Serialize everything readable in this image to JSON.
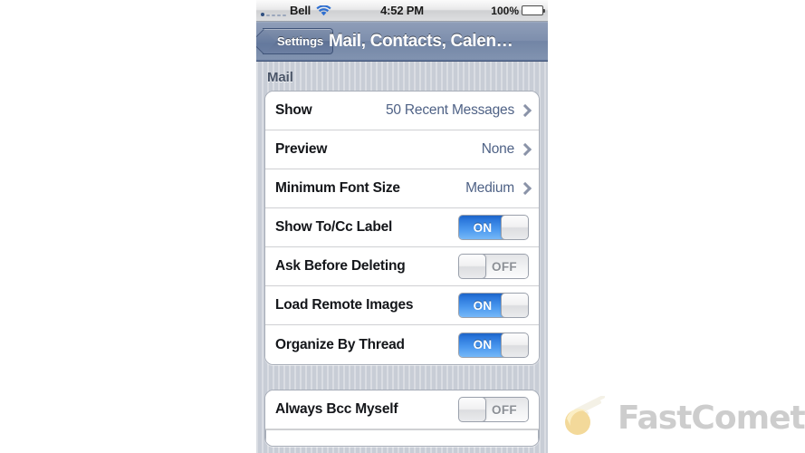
{
  "status_bar": {
    "carrier": "Bell",
    "wifi_icon": "wifi-icon",
    "time": "4:52 PM",
    "battery_percent": "100%",
    "battery_icon": "battery-full-icon",
    "signal_icon": "signal-dots-icon"
  },
  "nav_bar": {
    "back_label": "Settings",
    "title": "Mail, Contacts, Calen…"
  },
  "sections": [
    {
      "header": "Mail",
      "rows": [
        {
          "label": "Show",
          "type": "disclosure",
          "value": "50 Recent Messages"
        },
        {
          "label": "Preview",
          "type": "disclosure",
          "value": "None"
        },
        {
          "label": "Minimum Font Size",
          "type": "disclosure",
          "value": "Medium"
        },
        {
          "label": "Show To/Cc Label",
          "type": "switch",
          "value": "ON",
          "state": "on"
        },
        {
          "label": "Ask Before Deleting",
          "type": "switch",
          "value": "OFF",
          "state": "off"
        },
        {
          "label": "Load Remote Images",
          "type": "switch",
          "value": "ON",
          "state": "on"
        },
        {
          "label": "Organize By Thread",
          "type": "switch",
          "value": "ON",
          "state": "on"
        }
      ]
    },
    {
      "header": "",
      "rows": [
        {
          "label": "Always Bcc Myself",
          "type": "switch",
          "value": "OFF",
          "state": "off"
        }
      ]
    }
  ],
  "watermark": {
    "text": "FastComet",
    "logo_icon": "comet-icon"
  },
  "colors": {
    "accent_blue": "#2c78dc",
    "nav_bar": "#7e8fad",
    "value_text": "#4f6286",
    "background": "#c8cdd6",
    "battery_green": "#6dc52c",
    "watermark_gray": "#cdcdcd",
    "watermark_yellow": "#f7dd9a"
  }
}
